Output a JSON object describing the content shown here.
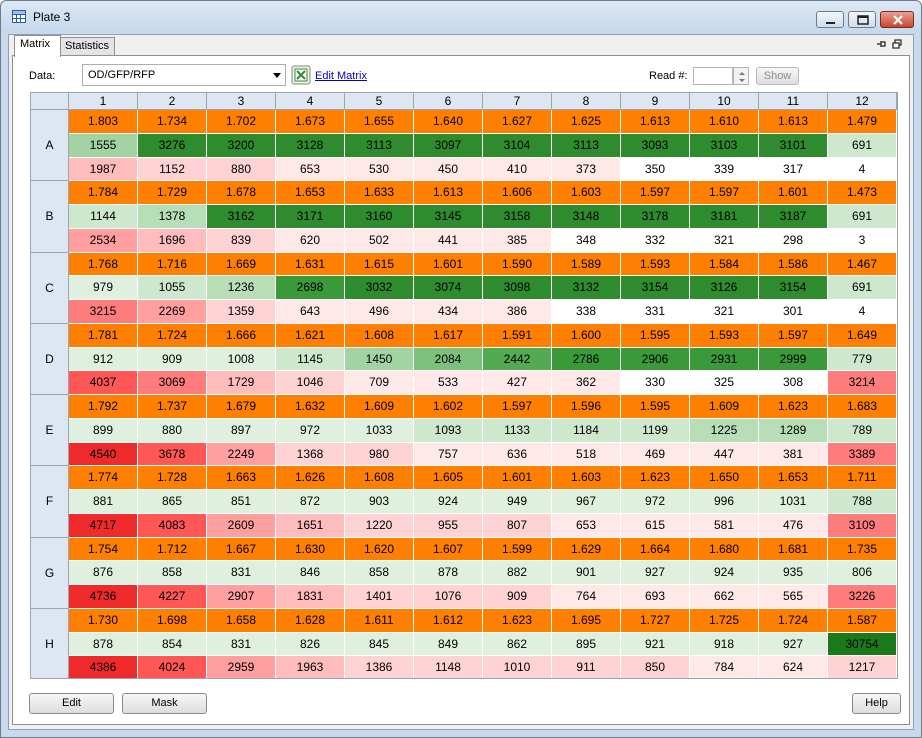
{
  "window": {
    "title": "Plate 3"
  },
  "tabs": [
    {
      "label": "Matrix"
    },
    {
      "label": "Statistics"
    }
  ],
  "toolbar": {
    "data_label": "Data:",
    "data_value": "OD/GFP/RFP",
    "edit_matrix_link": "Edit Matrix",
    "read_label": "Read #:",
    "read_value": "",
    "show_button": "Show"
  },
  "buttons": {
    "edit": "Edit",
    "mask": "Mask",
    "help": "Help"
  },
  "colors": {
    "od": "#ff8000",
    "gfp_scale": [
      "#dff0df",
      "#cde8cd",
      "#b8deb8",
      "#a3d3a3",
      "#7cc07c",
      "#52ab52",
      "#3a9a3a",
      "#2e8c2e",
      "#1a7a1a"
    ],
    "rfp_scale": [
      "#ffffff",
      "#ffe8e8",
      "#ffd3d3",
      "#ffbcbc",
      "#ff9f9f",
      "#ff7c7c",
      "#ff5656",
      "#f02a2a"
    ]
  },
  "matrix": {
    "columns": [
      "1",
      "2",
      "3",
      "4",
      "5",
      "6",
      "7",
      "8",
      "9",
      "10",
      "11",
      "12"
    ],
    "rows": [
      {
        "label": "A",
        "od": [
          "1.803",
          "1.734",
          "1.702",
          "1.673",
          "1.655",
          "1.640",
          "1.627",
          "1.625",
          "1.613",
          "1.610",
          "1.613",
          "1.479"
        ],
        "gfp": [
          "1555",
          "3276",
          "3200",
          "3128",
          "3113",
          "3097",
          "3104",
          "3113",
          "3093",
          "3103",
          "3101",
          "691"
        ],
        "rfp": [
          "1987",
          "1152",
          "880",
          "653",
          "530",
          "450",
          "410",
          "373",
          "350",
          "339",
          "317",
          "4"
        ]
      },
      {
        "label": "B",
        "od": [
          "1.784",
          "1.729",
          "1.678",
          "1.653",
          "1.633",
          "1.613",
          "1.606",
          "1.603",
          "1.597",
          "1.597",
          "1.601",
          "1.473"
        ],
        "gfp": [
          "1144",
          "1378",
          "3162",
          "3171",
          "3160",
          "3145",
          "3158",
          "3148",
          "3178",
          "3181",
          "3187",
          "691"
        ],
        "rfp": [
          "2534",
          "1696",
          "839",
          "620",
          "502",
          "441",
          "385",
          "348",
          "332",
          "321",
          "298",
          "3"
        ]
      },
      {
        "label": "C",
        "od": [
          "1.768",
          "1.716",
          "1.669",
          "1.631",
          "1.615",
          "1.601",
          "1.590",
          "1.589",
          "1.593",
          "1.584",
          "1.586",
          "1.467"
        ],
        "gfp": [
          "979",
          "1055",
          "1236",
          "2698",
          "3032",
          "3074",
          "3098",
          "3132",
          "3154",
          "3126",
          "3154",
          "691"
        ],
        "rfp": [
          "3215",
          "2269",
          "1359",
          "643",
          "496",
          "434",
          "386",
          "338",
          "331",
          "321",
          "301",
          "4"
        ]
      },
      {
        "label": "D",
        "od": [
          "1.781",
          "1.724",
          "1.666",
          "1.621",
          "1.608",
          "1.617",
          "1.591",
          "1.600",
          "1.595",
          "1.593",
          "1.597",
          "1.649"
        ],
        "gfp": [
          "912",
          "909",
          "1008",
          "1145",
          "1450",
          "2084",
          "2442",
          "2786",
          "2906",
          "2931",
          "2999",
          "779"
        ],
        "rfp": [
          "4037",
          "3069",
          "1729",
          "1046",
          "709",
          "533",
          "427",
          "362",
          "330",
          "325",
          "308",
          "3214"
        ]
      },
      {
        "label": "E",
        "od": [
          "1.792",
          "1.737",
          "1.679",
          "1.632",
          "1.609",
          "1.602",
          "1.597",
          "1.596",
          "1.595",
          "1.609",
          "1.623",
          "1.683"
        ],
        "gfp": [
          "899",
          "880",
          "897",
          "972",
          "1033",
          "1093",
          "1133",
          "1184",
          "1199",
          "1225",
          "1289",
          "789"
        ],
        "rfp": [
          "4540",
          "3678",
          "2249",
          "1368",
          "980",
          "757",
          "636",
          "518",
          "469",
          "447",
          "381",
          "3389"
        ]
      },
      {
        "label": "F",
        "od": [
          "1.774",
          "1.728",
          "1.663",
          "1.626",
          "1.608",
          "1.605",
          "1.601",
          "1.603",
          "1.623",
          "1.650",
          "1.653",
          "1.711"
        ],
        "gfp": [
          "881",
          "865",
          "851",
          "872",
          "903",
          "924",
          "949",
          "967",
          "972",
          "996",
          "1031",
          "788"
        ],
        "rfp": [
          "4717",
          "4083",
          "2609",
          "1651",
          "1220",
          "955",
          "807",
          "653",
          "615",
          "581",
          "476",
          "3109"
        ]
      },
      {
        "label": "G",
        "od": [
          "1.754",
          "1.712",
          "1.667",
          "1.630",
          "1.620",
          "1.607",
          "1.599",
          "1.629",
          "1.664",
          "1.680",
          "1.681",
          "1.735"
        ],
        "gfp": [
          "876",
          "858",
          "831",
          "846",
          "858",
          "878",
          "882",
          "901",
          "927",
          "924",
          "935",
          "806"
        ],
        "rfp": [
          "4736",
          "4227",
          "2907",
          "1831",
          "1401",
          "1076",
          "909",
          "764",
          "693",
          "662",
          "565",
          "3226"
        ]
      },
      {
        "label": "H",
        "od": [
          "1.730",
          "1.698",
          "1.658",
          "1.628",
          "1.611",
          "1.612",
          "1.623",
          "1.695",
          "1.727",
          "1.725",
          "1.724",
          "1.587"
        ],
        "gfp": [
          "878",
          "854",
          "831",
          "826",
          "845",
          "849",
          "862",
          "895",
          "921",
          "918",
          "927",
          "30754"
        ],
        "rfp": [
          "4386",
          "4024",
          "2959",
          "1963",
          "1386",
          "1148",
          "1010",
          "911",
          "850",
          "784",
          "624",
          "1217"
        ]
      }
    ]
  }
}
